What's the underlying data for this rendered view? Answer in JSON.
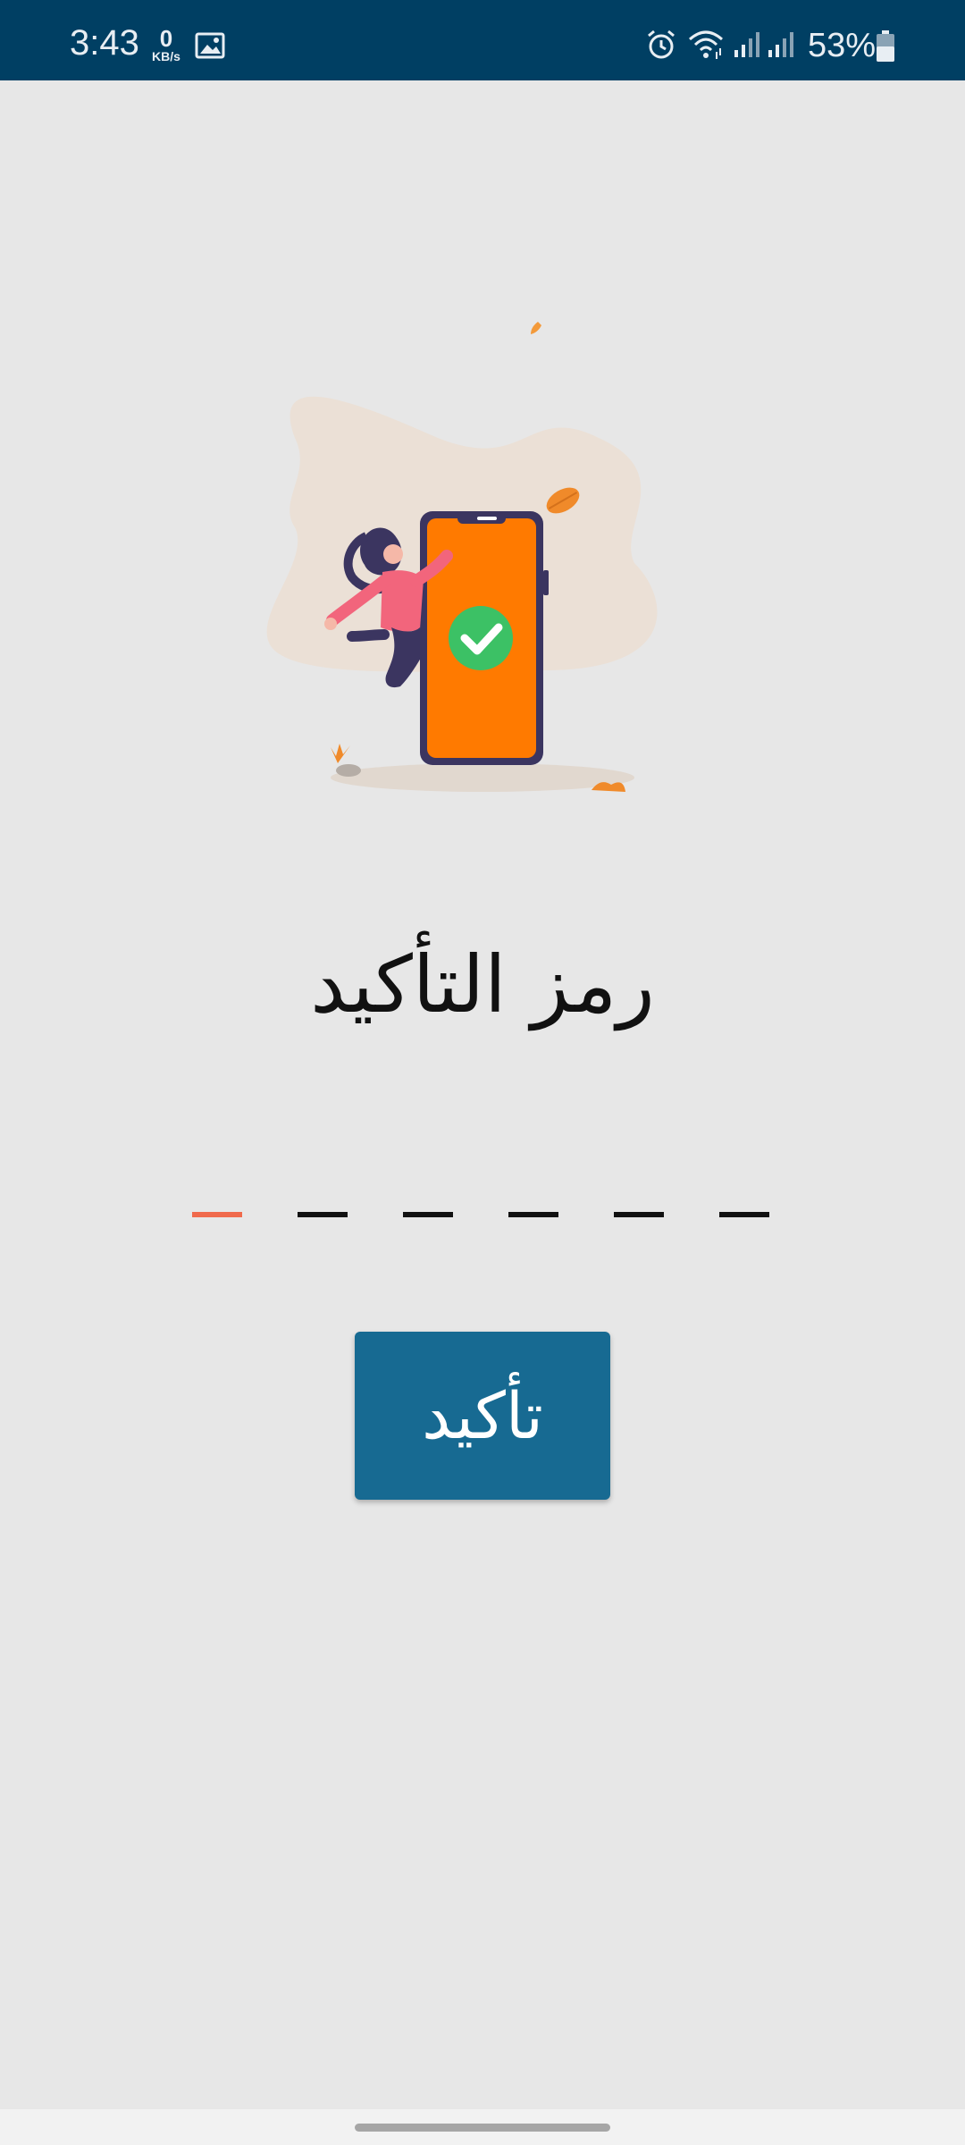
{
  "status_bar": {
    "time": "3:43",
    "net_speed_value": "0",
    "net_speed_unit": "KB/s",
    "battery_percent": "53%",
    "icons": [
      "image-icon",
      "alarm-icon",
      "wifi-icon",
      "signal-icon",
      "signal-icon",
      "battery-icon"
    ]
  },
  "illustration": {
    "name": "verification-illustration",
    "colors": {
      "phone": "#ff7a00",
      "check": "#3cc165",
      "blob": "#ebe0d6"
    }
  },
  "main": {
    "title": "رمز التأكيد",
    "code_length": 6,
    "active_slot": 0,
    "active_color": "#f06a4c",
    "confirm_label": "تأكيد",
    "button_color": "#176a92"
  }
}
